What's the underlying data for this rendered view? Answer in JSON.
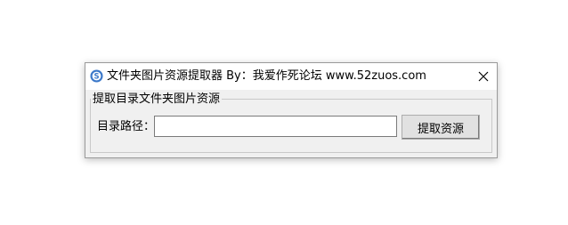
{
  "window": {
    "title": "文件夹图片资源提取器  By：我爱作死论坛  www.52zuos.com"
  },
  "group": {
    "legend": "提取目录文件夹图片资源"
  },
  "path_field": {
    "label": "目录路径：",
    "value": "",
    "placeholder": ""
  },
  "buttons": {
    "extract_label": "提取资源"
  },
  "icons": {
    "app": "app-logo-icon",
    "close": "close-icon"
  },
  "colors": {
    "app_icon_blue": "#3b78c9",
    "window_bg": "#f0f0f0",
    "titlebar_bg": "#ffffff"
  }
}
